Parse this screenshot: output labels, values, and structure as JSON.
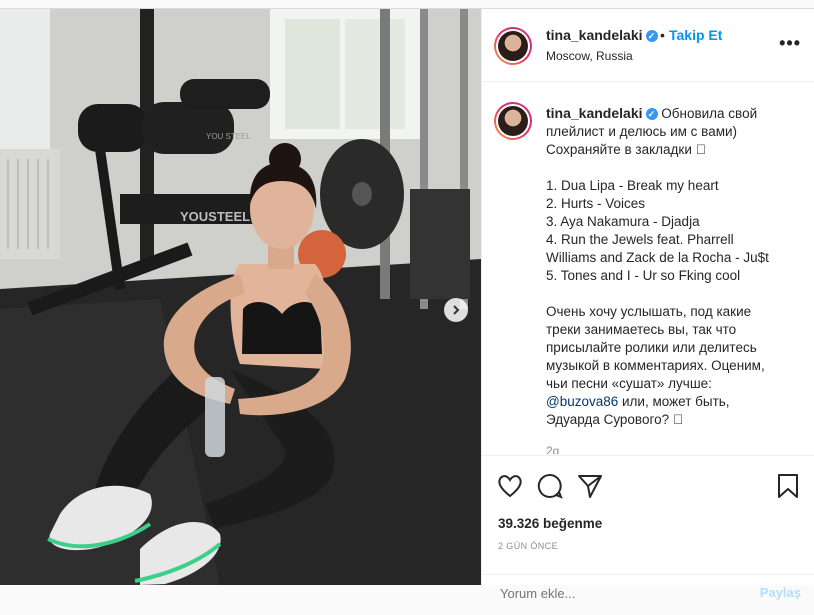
{
  "post": {
    "author": "tina_kandelaki",
    "location": "Moscow, Russia",
    "follow_label": "Takip Et",
    "separator": "•",
    "more_label": "•••",
    "caption_lines_1": [
      "Обновила свой",
      "плейлист и делюсь им с вами)",
      "Сохраняйте в закладки ⃞"
    ],
    "playlist": [
      "1. Dua Lipa - Break my heart",
      "2. Hurts - Voices",
      "3. Aya Nakamura - Djadja",
      "4. Run the Jewels feat. Pharrell",
      "Williams and Zack de la Rocha - Ju$t",
      "5. Tones and I - Ur so Fking cool"
    ],
    "caption_lines_2": [
      "Очень хочу услышать, под какие",
      "треки занимаетесь вы, так что",
      "присылайте ролики или делитесь",
      "музыкой в комментариях. Оценим,",
      "чьи песни «сушат» лучше:"
    ],
    "mention": "@buzova86",
    "mention_tail": " или, может быть,",
    "caption_last": "Эдуарда Сурового? ⃞",
    "caption_time": "2g",
    "likes": "39.326 beğenme",
    "posted": "2 GÜN ÖNCE",
    "comment_placeholder": "Yorum ekle...",
    "share_label": "Paylaş"
  },
  "photo": {
    "brand_text": "YOUSTEEL",
    "pad_text": "YOU STEEL"
  },
  "colors": {
    "accent": "#0095f6",
    "verified": "#3897f0"
  }
}
